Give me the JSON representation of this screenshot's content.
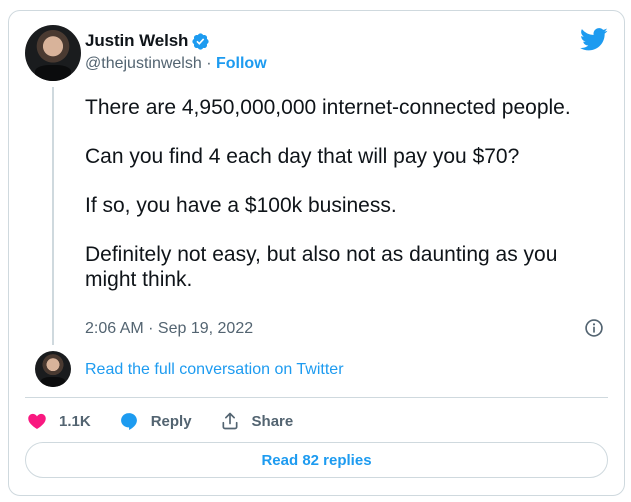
{
  "author": {
    "name": "Justin Welsh",
    "handle": "@thejustinwelsh",
    "separator": "·",
    "follow_label": "Follow",
    "verified": true
  },
  "tweet": {
    "paragraphs": [
      "There are 4,950,000,000 internet-connected people.",
      "Can you find 4 each day that will pay you $70?",
      "If so, you have a $100k business.",
      "Definitely not easy, but also not as daunting as you might think."
    ],
    "timestamp": "2:06 AM · Sep 19, 2022"
  },
  "conversation_link": "Read the full conversation on Twitter",
  "actions": {
    "like_count": "1.1K",
    "reply_label": "Reply",
    "share_label": "Share"
  },
  "replies_button": "Read 82 replies",
  "colors": {
    "accent": "#1d9bf0",
    "like": "#f91880",
    "text": "#0f1419",
    "muted": "#536471",
    "border": "#cfd9de"
  },
  "icons": [
    "verified-badge-icon",
    "twitter-bird-icon",
    "info-icon",
    "heart-icon",
    "reply-bubble-icon",
    "share-icon"
  ]
}
